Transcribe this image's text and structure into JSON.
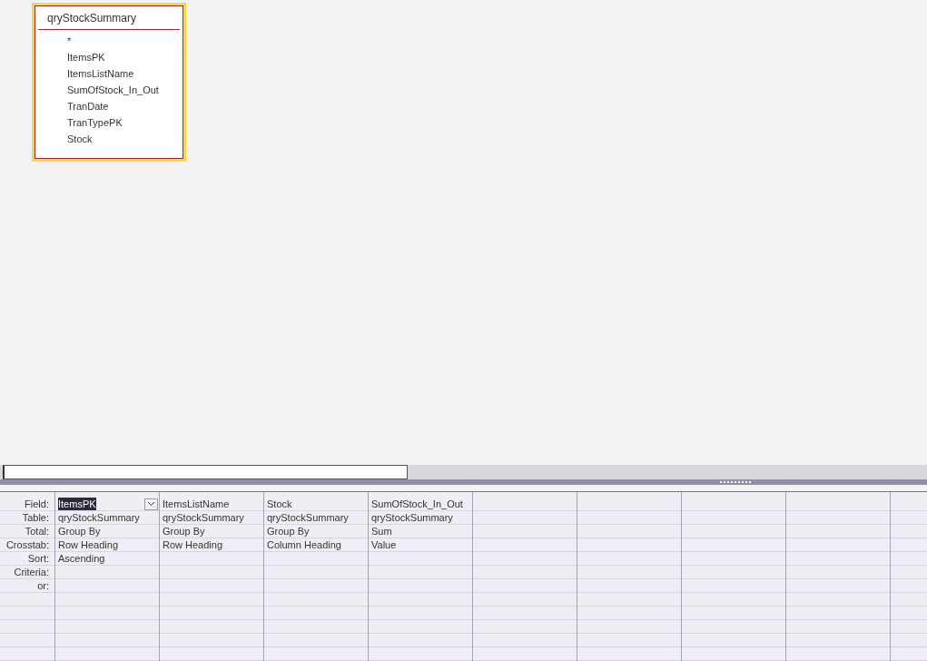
{
  "table_box": {
    "title": "qryStockSummary",
    "fields": [
      "*",
      "ItemsPK",
      "ItemsListName",
      "SumOfStock_In_Out",
      "TranDate",
      "TranTypePK",
      "Stock"
    ]
  },
  "grid": {
    "row_labels": [
      "Field:",
      "Table:",
      "Total:",
      "Crosstab:",
      "Sort:",
      "Criteria:",
      "or:"
    ],
    "columns": [
      {
        "field": "ItemsPK",
        "selected": true,
        "table": "qryStockSummary",
        "total": "Group By",
        "crosstab": "Row Heading",
        "sort": "Ascending"
      },
      {
        "field": "ItemsListName",
        "selected": false,
        "table": "qryStockSummary",
        "total": "Group By",
        "crosstab": "Row Heading"
      },
      {
        "field": "Stock",
        "selected": false,
        "table": "qryStockSummary",
        "total": "Group By",
        "crosstab": "Column Heading"
      },
      {
        "field": "SumOfStock_In_Out",
        "selected": false,
        "table": "qryStockSummary",
        "total": "Sum",
        "crosstab": "Value"
      }
    ]
  }
}
